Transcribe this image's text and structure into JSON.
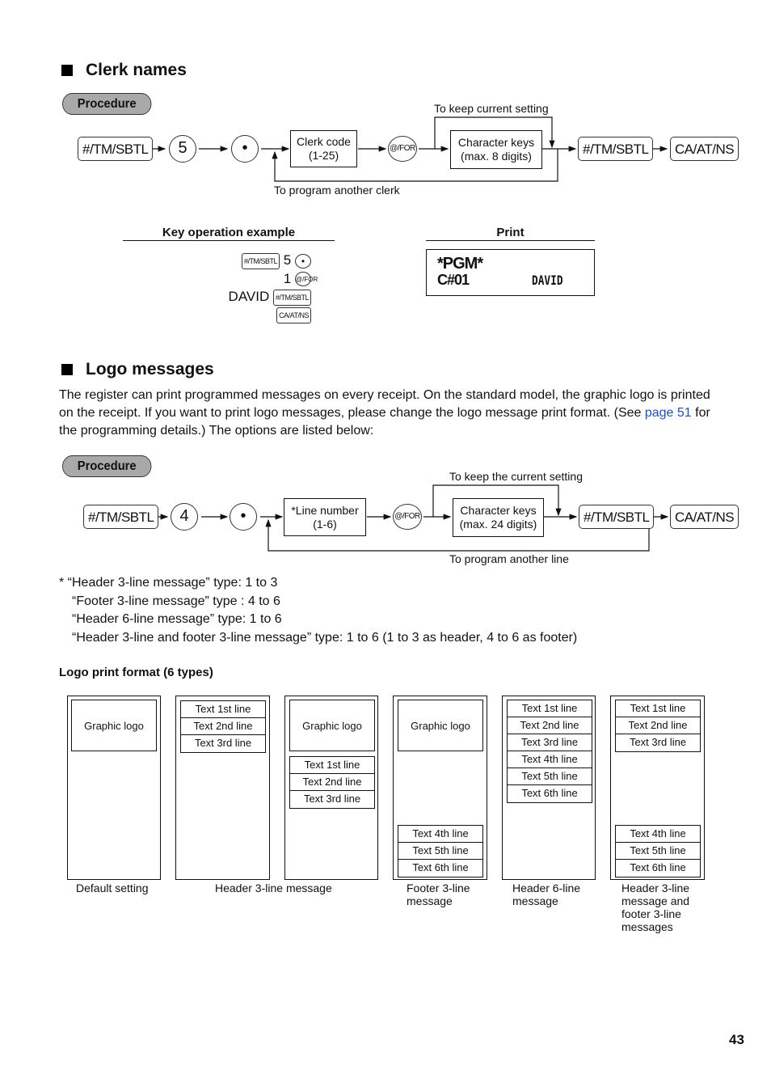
{
  "clerk_section": {
    "title": "Clerk names",
    "procedure_label": "Procedure",
    "flow": {
      "key_sbtl": "#/TM/SBTL",
      "key_5": "5",
      "key_dot": "•",
      "box_clerk_code_line1": "Clerk code",
      "box_clerk_code_line2": "(1-25)",
      "key_for": "@/FOR",
      "box_chars_line1": "Character keys",
      "box_chars_line2": "(max. 8 digits)",
      "key_sbtl2": "#/TM/SBTL",
      "key_caatns": "CA/AT/NS",
      "note_keep": "To keep current setting",
      "note_another": "To program another clerk"
    },
    "example": {
      "heading": "Key operation example",
      "row1_key": "#/TM/SBTL",
      "row1_num": "5",
      "row1_circ": "•",
      "row2_num": "1",
      "row2_circ": "@/FOR",
      "row3_text": "DAVID",
      "row3_key": "#/TM/SBTL",
      "row4_key": "CA/AT/NS"
    },
    "print": {
      "heading": "Print",
      "line1": "*PGM*",
      "line2_left": "C#01",
      "line2_right": "DAVID"
    }
  },
  "logo_section": {
    "title": "Logo messages",
    "para_part1": "The register can print programmed messages on every receipt. On the standard model, the graphic logo is printed on the receipt.  If you want to print logo messages, please change the logo message print format. (See ",
    "para_link": "page 51",
    "para_part2": " for the programming details.)  The options are listed below:",
    "procedure_label": "Procedure",
    "flow": {
      "key_sbtl": "#/TM/SBTL",
      "key_4": "4",
      "key_dot": "•",
      "box_line_line1": "*Line number",
      "box_line_line2": "(1-6)",
      "key_for": "@/FOR",
      "box_chars_line1": "Character keys",
      "box_chars_line2": "(max. 24 digits)",
      "key_sbtl2": "#/TM/SBTL",
      "key_caatns": "CA/AT/NS",
      "note_keep": "To keep the current setting",
      "note_another": "To program another line"
    },
    "notes": [
      "*  “Header 3-line message” type: 1 to 3",
      "“Footer 3-line message” type  : 4 to 6",
      "“Header 6-line message” type: 1 to 6",
      "“Header 3-line and footer 3-line message” type: 1 to 6 (1 to 3 as header, 4 to 6 as footer)"
    ],
    "format_heading": "Logo print format (6 types)",
    "graphic_logo": "Graphic logo",
    "lines": [
      "Text 1st line",
      "Text 2nd line",
      "Text 3rd line",
      "Text 4th line",
      "Text 5th line",
      "Text 6th line"
    ],
    "captions": {
      "default": "Default setting",
      "header3": "Header 3-line message",
      "footer3": [
        "Footer 3-line",
        "message"
      ],
      "header6": [
        "Header 6-line",
        "message"
      ],
      "both": [
        "Header 3-line",
        "message and",
        "footer 3-line",
        "messages"
      ]
    }
  },
  "page_number": "43"
}
